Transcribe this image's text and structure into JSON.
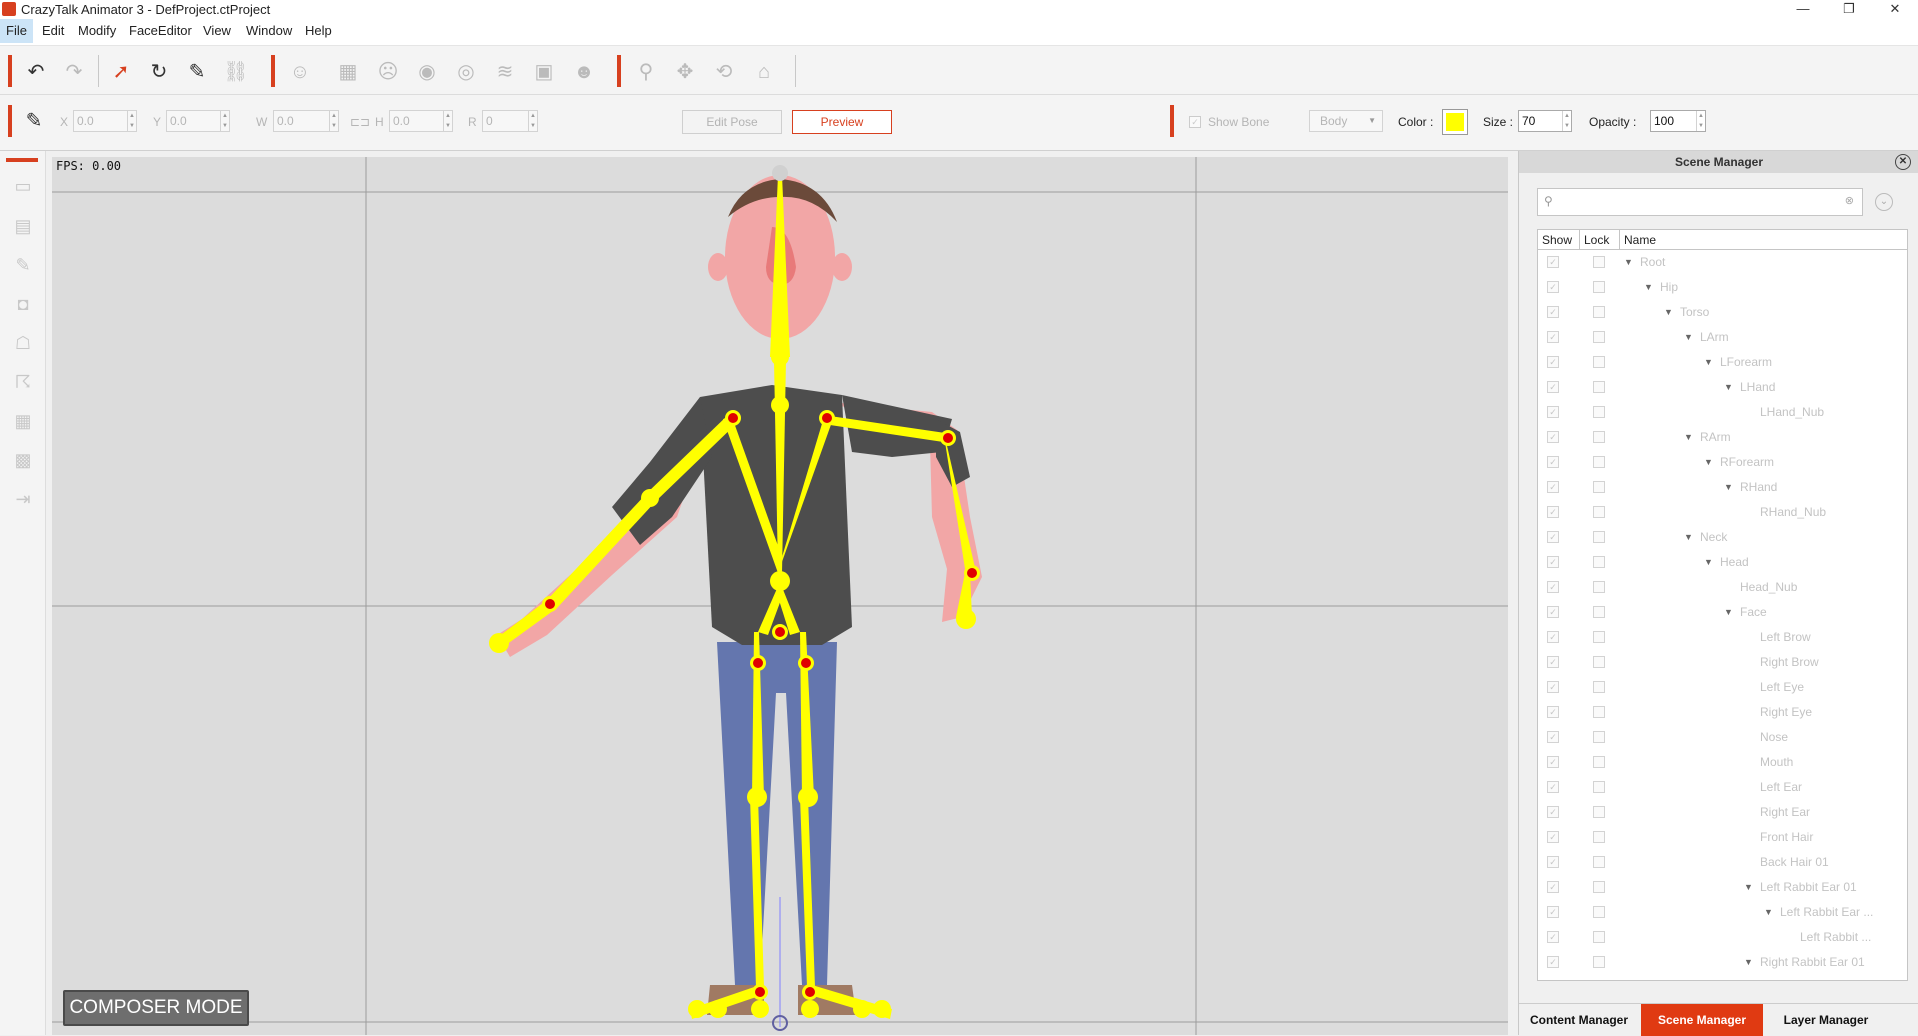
{
  "window": {
    "title": "CrazyTalk Animator 3  - DefProject.ctProject",
    "minimize": "—",
    "restore": "❐",
    "close": "✕"
  },
  "menu": [
    "File",
    "Edit",
    "Modify",
    "FaceEditor",
    "View",
    "Window",
    "Help"
  ],
  "transform": {
    "x_label": "X",
    "x_value": "0.0",
    "y_label": "Y",
    "y_value": "0.0",
    "w_label": "W",
    "w_value": "0.0",
    "h_label": "H",
    "h_value": "0.0",
    "r_label": "R",
    "r_value": "0"
  },
  "pose": {
    "edit_pose": "Edit Pose",
    "preview": "Preview"
  },
  "bone": {
    "show_bone": "Show Bone",
    "body_select": "Body",
    "color_label": "Color :",
    "color_value": "#ffff00",
    "size_label": "Size :",
    "size_value": "70",
    "opacity_label": "Opacity :",
    "opacity_value": "100"
  },
  "viewport": {
    "fps": "FPS: 0.00",
    "mode_badge": "COMPOSER MODE"
  },
  "scene_manager": {
    "title": "Scene Manager",
    "columns": [
      "Show",
      "Lock",
      "Name"
    ],
    "nodes": [
      {
        "name": "Root",
        "level": 0,
        "expander": true
      },
      {
        "name": "Hip",
        "level": 1,
        "expander": true
      },
      {
        "name": "Torso",
        "level": 2,
        "expander": true
      },
      {
        "name": "LArm",
        "level": 3,
        "expander": true
      },
      {
        "name": "LForearm",
        "level": 4,
        "expander": true
      },
      {
        "name": "LHand",
        "level": 5,
        "expander": true
      },
      {
        "name": "LHand_Nub",
        "level": 6,
        "expander": false
      },
      {
        "name": "RArm",
        "level": 3,
        "expander": true
      },
      {
        "name": "RForearm",
        "level": 4,
        "expander": true
      },
      {
        "name": "RHand",
        "level": 5,
        "expander": true
      },
      {
        "name": "RHand_Nub",
        "level": 6,
        "expander": false
      },
      {
        "name": "Neck",
        "level": 3,
        "expander": true
      },
      {
        "name": "Head",
        "level": 4,
        "expander": true
      },
      {
        "name": "Head_Nub",
        "level": 5,
        "expander": false
      },
      {
        "name": "Face",
        "level": 5,
        "expander": true
      },
      {
        "name": "Left Brow",
        "level": 6,
        "expander": false
      },
      {
        "name": "Right Brow",
        "level": 6,
        "expander": false
      },
      {
        "name": "Left Eye",
        "level": 6,
        "expander": false
      },
      {
        "name": "Right Eye",
        "level": 6,
        "expander": false
      },
      {
        "name": "Nose",
        "level": 6,
        "expander": false
      },
      {
        "name": "Mouth",
        "level": 6,
        "expander": false
      },
      {
        "name": "Left Ear",
        "level": 6,
        "expander": false
      },
      {
        "name": "Right Ear",
        "level": 6,
        "expander": false
      },
      {
        "name": "Front Hair",
        "level": 6,
        "expander": false
      },
      {
        "name": "Back Hair 01",
        "level": 6,
        "expander": false
      },
      {
        "name": "Left Rabbit Ear 01",
        "level": 6,
        "expander": true
      },
      {
        "name": "Left Rabbit Ear ...",
        "level": 7,
        "expander": true
      },
      {
        "name": "Left Rabbit ...",
        "level": 8,
        "expander": false
      },
      {
        "name": "Right Rabbit Ear 01",
        "level": 6,
        "expander": true
      }
    ]
  },
  "bottom_tabs": [
    "Content Manager",
    "Scene Manager",
    "Layer Manager"
  ],
  "colors": {
    "accent": "#d7401f",
    "bone": "#ffff00",
    "joint": "#e00000",
    "active_tab": "#e03a12"
  }
}
